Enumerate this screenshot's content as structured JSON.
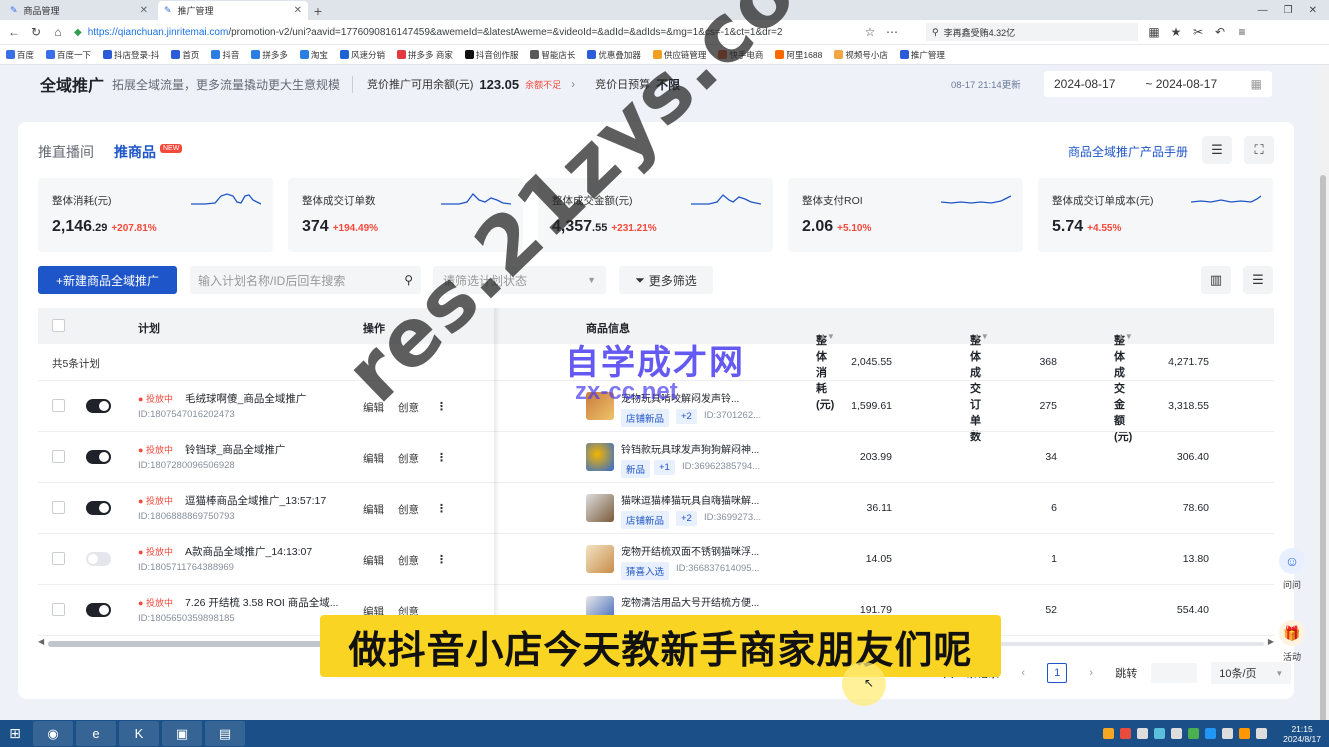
{
  "browser": {
    "tabs": [
      {
        "label": "商品管理",
        "active": false
      },
      {
        "label": "推广管理",
        "active": true
      }
    ],
    "url_host": "https://qianchuan.jinritemai.com",
    "url_path": "/promotion-v2/uni?aavid=1776090816147459&awemeId=&latestAweme=&videoId=&adId=&adIds=&mg=1&cs=-1&ct=1&dr=2",
    "search_text": "李再鑫受贿4.32亿",
    "bookmarks": [
      "百度",
      "百度一下",
      "抖店登录-抖",
      "首页",
      "抖音",
      "拼多多",
      "淘宝",
      "风速分销",
      "拼多多 商家",
      "抖音创作服",
      "智能店长",
      "优惠叠加器",
      "供应链管理",
      "快手电商",
      "阿里1688",
      "视频号小店",
      "推广管理"
    ]
  },
  "header": {
    "title": "全域推广",
    "subtitle": "拓展全域流量，更多流量撬动更大生意规模",
    "balance_label": "竞价推广可用余额(元)",
    "balance_value": "123.05",
    "balance_warning": "余额不足",
    "budget_label": "竞价日预算",
    "budget_value": "不限",
    "updated": "08-17 21:14更新",
    "date_start": "2024-08-17",
    "date_end": "~ 2024-08-17"
  },
  "card": {
    "tabs": [
      {
        "label": "推直播间",
        "active": false
      },
      {
        "label": "推商品",
        "active": true
      }
    ],
    "new_badge": "NEW",
    "manual_link": "商品全域推广产品手册"
  },
  "metrics": [
    {
      "label": "整体消耗(元)",
      "value_int": "2,146",
      "value_dec": ".29",
      "change": "+207.81%"
    },
    {
      "label": "整体成交订单数",
      "value_int": "374",
      "value_dec": "",
      "change": "+194.49%"
    },
    {
      "label": "整体成交金额(元)",
      "value_int": "4,357",
      "value_dec": ".55",
      "change": "+231.21%"
    },
    {
      "label": "整体支付ROI",
      "value_int": "2.06",
      "value_dec": "",
      "change": "+5.10%"
    },
    {
      "label": "整体成交订单成本(元)",
      "value_int": "5.74",
      "value_dec": "",
      "change": "+4.55%"
    }
  ],
  "toolbar": {
    "create_label": "+新建商品全域推广",
    "search_placeholder": "输入计划名称/ID后回车搜索",
    "status_placeholder": "请筛选计划状态",
    "more_filter": "更多筛选"
  },
  "table": {
    "headers": {
      "plan": "计划",
      "ops": "操作",
      "product": "商品信息",
      "cost": "整体消耗(元)",
      "orders": "整体成交订单数",
      "amount": "整体成交金额(元)"
    },
    "summary": {
      "label": "共5条计划",
      "cost": "2,045.55",
      "orders": "368",
      "amount": "4,271.75"
    },
    "op_edit": "编辑",
    "op_creative": "创意",
    "rows": [
      {
        "status": "投放中",
        "name": "毛绒球啊傻_商品全域推广",
        "id": "ID:1807547016202473",
        "on": true,
        "product": "宠物玩具啃咬解闷发声铃...",
        "tag": "店铺新品",
        "tag_plus": "+2",
        "product_id": "ID:3701262...",
        "cost": "1,599.61",
        "orders": "275",
        "amount": "3,318.55"
      },
      {
        "status": "投放中",
        "name": "铃铛球_商品全域推广",
        "id": "ID:1807280096506928",
        "on": true,
        "product": "铃铛款玩具球发声狗狗解闷神...",
        "tag": "新品",
        "tag_plus": "+1",
        "product_id": "ID:36962385794...",
        "cost": "203.99",
        "orders": "34",
        "amount": "306.40"
      },
      {
        "status": "投放中",
        "name": "逗猫棒商品全域推广_13:57:17",
        "id": "ID:1806888869750793",
        "on": true,
        "product": "猫咪逗猫棒猫玩具自嗨猫咪解...",
        "tag": "店铺新品",
        "tag_plus": "+2",
        "product_id": "ID:3699273...",
        "cost": "36.11",
        "orders": "6",
        "amount": "78.60"
      },
      {
        "status": "投放中",
        "name": "A款商品全域推广_14:13:07",
        "id": "ID:1805711764388969",
        "on": false,
        "product": "宠物开结梳双面不锈钢猫咪浮...",
        "tag": "猜喜入选",
        "tag_plus": "",
        "product_id": "ID:366837614095...",
        "cost": "14.05",
        "orders": "1",
        "amount": "13.80"
      },
      {
        "status": "投放中",
        "name": "7.26 开结梳 3.58 ROI 商品全域...",
        "id": "ID:1805650359898185",
        "on": true,
        "product": "宠物清洁用品大号开结梳方便...",
        "tag": "",
        "tag_plus": "",
        "product_id": "",
        "cost": "191.79",
        "orders": "52",
        "amount": "554.40"
      }
    ]
  },
  "pager": {
    "total": "共 5 条记录",
    "current": "1",
    "jump_label": "跳转",
    "per_page": "10条/页"
  },
  "float": {
    "ask": "问问",
    "activity": "活动"
  },
  "overlay": {
    "caption": "做抖音小店今天教新手商家朋友们呢",
    "watermark": "res.21zys.com",
    "logo_top": "自学成才网",
    "logo_bottom": "zx-cc.net"
  },
  "taskbar": {
    "time": "21:15",
    "date": "2024/8/17"
  }
}
